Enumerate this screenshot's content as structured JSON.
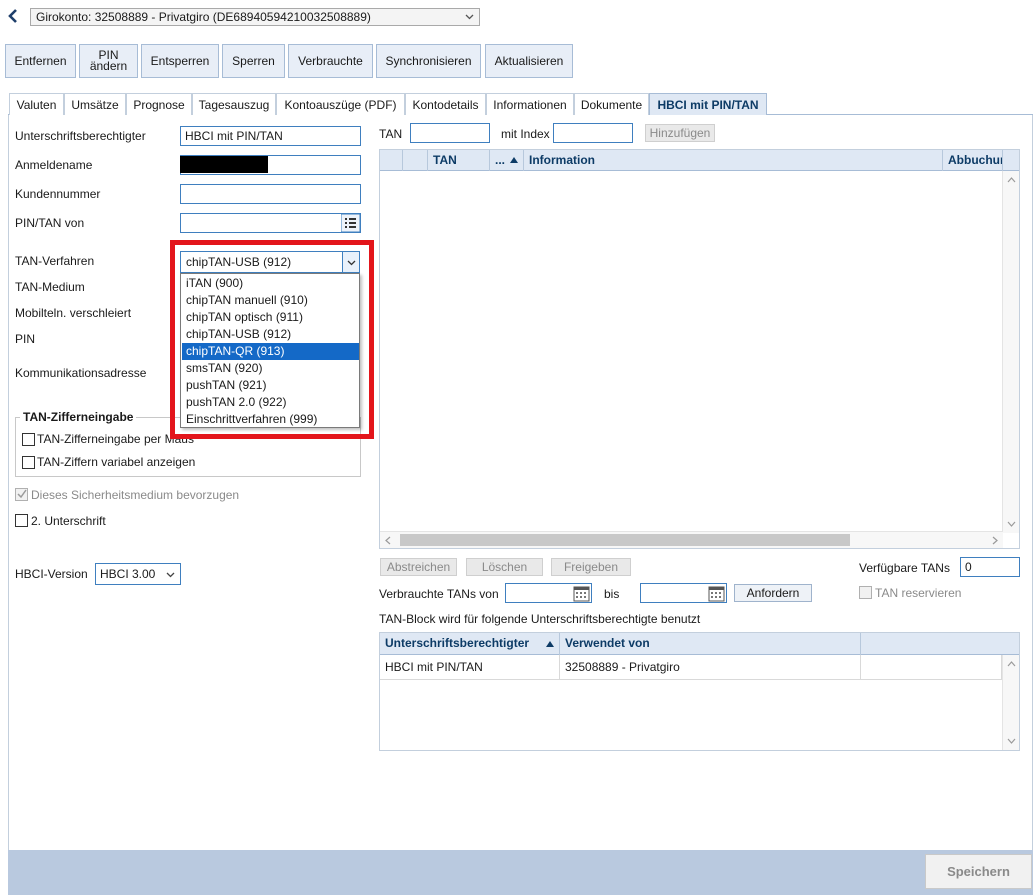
{
  "account": {
    "selected": "Girokonto: 32508889 - Privatgiro (DE68940594210032508889)"
  },
  "toolbar": {
    "remove": "Entfernen",
    "pin_line1": "PIN",
    "pin_line2": "ändern",
    "unlock": "Entsperren",
    "lock": "Sperren",
    "used": "Verbrauchte",
    "sync": "Synchronisieren",
    "refresh": "Aktualisieren"
  },
  "tabs": [
    "Valuten",
    "Umsätze",
    "Prognose",
    "Tagesauszug",
    "Kontoauszüge (PDF)",
    "Kontodetails",
    "Informationen",
    "Dokumente",
    "HBCI mit PIN/TAN"
  ],
  "form": {
    "signatory_label": "Unterschriftsberechtigter",
    "signatory_value": "HBCI mit PIN/TAN",
    "login_label": "Anmeldename",
    "customer_label": "Kundennummer",
    "pintan_label": "PIN/TAN von",
    "tanproc_label": "TAN-Verfahren",
    "tanproc_value": "chipTAN-USB (912)",
    "tanmedium_label": "TAN-Medium",
    "mobile_label": "Mobilteln. verschleiert",
    "pin_label": "PIN",
    "comm_label": "Kommunikationsadresse",
    "tan_digits_title": "TAN-Zifferneingabe",
    "tan_digits_mouse": "TAN-Zifferneingabe per Maus",
    "tan_digits_variable": "TAN-Ziffern variabel anzeigen",
    "prefer_medium": "Dieses Sicherheitsmedium bevorzugen",
    "second_signature": "2. Unterschrift",
    "hbci_version_label": "HBCI-Version",
    "hbci_version_value": "HBCI 3.00"
  },
  "tan_options": [
    "iTAN (900)",
    "chipTAN manuell (910)",
    "chipTAN optisch (911)",
    "chipTAN-USB (912)",
    "chipTAN-QR (913)",
    "smsTAN (920)",
    "pushTAN (921)",
    "pushTAN 2.0 (922)",
    "Einschrittverfahren (999)"
  ],
  "tan_entry": {
    "tan_label": "TAN",
    "index_label": "mit Index",
    "add_button": "Hinzufügen"
  },
  "tan_table": {
    "col_tan": "TAN",
    "col_sort": "...",
    "col_info": "Information",
    "col_debit": "Abbuchun"
  },
  "tan_actions": {
    "strike": "Abstreichen",
    "delete": "Löschen",
    "release": "Freigeben",
    "available_label": "Verfügbare TANs",
    "available_value": "0",
    "used_from": "Verbrauchte TANs von",
    "to": "bis",
    "request": "Anfordern",
    "reserve": "TAN reservieren",
    "block_info": "TAN-Block wird für folgende Unterschriftsberechtigte benutzt"
  },
  "signatory_table": {
    "col_signatory": "Unterschriftsberechtigter",
    "col_used_by": "Verwendet von",
    "rows": [
      {
        "signatory": "HBCI mit PIN/TAN",
        "used_by": "32508889 - Privatgiro"
      }
    ]
  },
  "footer": {
    "save": "Speichern"
  },
  "colors": {
    "accent": "#1469c7",
    "header_bg": "#dfe8f4",
    "footer_bg": "#b9c9df",
    "highlight": "#e3151b"
  }
}
